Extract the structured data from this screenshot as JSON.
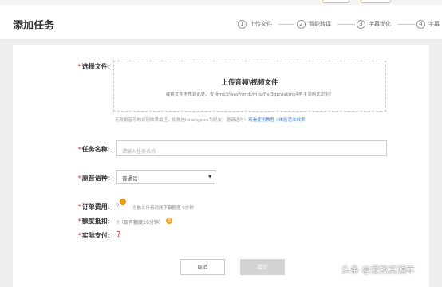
{
  "page_title": "添加任务",
  "steps": [
    {
      "num": "1",
      "label": "上传文件"
    },
    {
      "num": "2",
      "label": "智能转译"
    },
    {
      "num": "3",
      "label": "字幕优化"
    },
    {
      "num": "4",
      "label": "字幕"
    }
  ],
  "upload": {
    "label": "选择文件:",
    "title": "上传音频\\视频文件",
    "desc": "或将文件拖拽到此处，支持mp3/wav/rmvb/mov/flv/3gp/avi/mp4等主流格式识别！",
    "hint_prefix": "无背景音乐的识别效果最佳，加微信lixiangpica为好友，邀请送时！",
    "hint_link1": "观看使用教程",
    "hint_sep": " / ",
    "hint_link2": "体验范本效果"
  },
  "task_name": {
    "label": "任务名称:",
    "placeholder": "请输入任务名称"
  },
  "language": {
    "label": "原音语种:",
    "value": "普通话",
    "caret": "▼"
  },
  "order_fee": {
    "label": "订单费用:",
    "value": "?",
    "note": "当前文件将消耗字幕额度 0分钟"
  },
  "credit": {
    "label": "额度抵扣:",
    "text": "?（现有额度59分钟）",
    "icon_glyph": "加"
  },
  "payment": {
    "label": "实际支付:",
    "value": "?"
  },
  "buttons": {
    "cancel": "取消",
    "submit": "提交"
  },
  "watermark": "头条 @爱找资源库",
  "colors": {
    "required": "#e03030",
    "link": "#3a7bd5",
    "coin": "#f39c12",
    "submit_disabled": "#d4d4d4"
  }
}
